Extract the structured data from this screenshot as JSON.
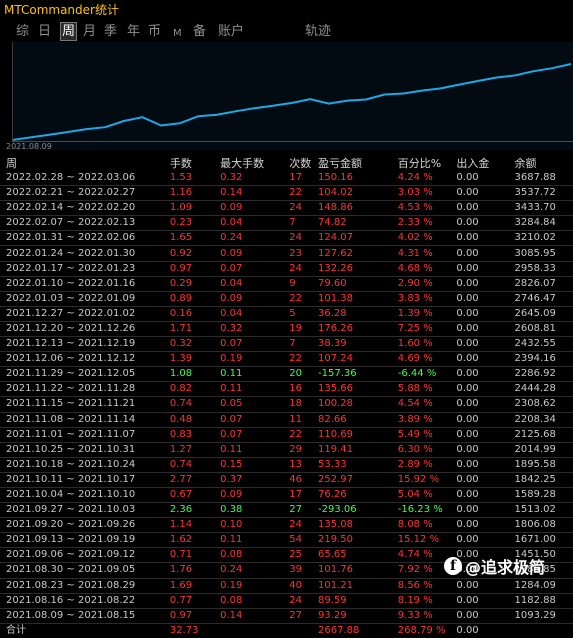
{
  "app": {
    "title": "MTCommander统计"
  },
  "tabs": [
    "综",
    "日",
    "周",
    "月",
    "季",
    "年",
    "币",
    "M",
    "备",
    "账户",
    "轨迹"
  ],
  "active_tab": "周",
  "chart": {
    "start_label": "2021.08.09",
    "line_color": "#1fa8e8"
  },
  "table": {
    "headers": [
      "周",
      "手数",
      "最大手数",
      "次数",
      "盈亏金额",
      "百分比%",
      "出入金",
      "余额"
    ],
    "rows": [
      {
        "week": "2022.02.28 ~ 2022.03.06",
        "lots": "1.53",
        "max_lots": "0.32",
        "count": "17",
        "pnl": "150.16",
        "pct": "4.24 %",
        "io": "0.00",
        "balance": "3687.88",
        "dir": "red"
      },
      {
        "week": "2022.02.21 ~ 2022.02.27",
        "lots": "1.16",
        "max_lots": "0.14",
        "count": "22",
        "pnl": "104.02",
        "pct": "3.03 %",
        "io": "0.00",
        "balance": "3537.72",
        "dir": "red"
      },
      {
        "week": "2022.02.14 ~ 2022.02.20",
        "lots": "1.09",
        "max_lots": "0.09",
        "count": "24",
        "pnl": "148.86",
        "pct": "4.53 %",
        "io": "0.00",
        "balance": "3433.70",
        "dir": "red"
      },
      {
        "week": "2022.02.07 ~ 2022.02.13",
        "lots": "0.23",
        "max_lots": "0.04",
        "count": "7",
        "pnl": "74.82",
        "pct": "2.33 %",
        "io": "0.00",
        "balance": "3284.84",
        "dir": "red"
      },
      {
        "week": "2022.01.31 ~ 2022.02.06",
        "lots": "1.65",
        "max_lots": "0.24",
        "count": "24",
        "pnl": "124.07",
        "pct": "4.02 %",
        "io": "0.00",
        "balance": "3210.02",
        "dir": "red"
      },
      {
        "week": "2022.01.24 ~ 2022.01.30",
        "lots": "0.92",
        "max_lots": "0.09",
        "count": "23",
        "pnl": "127.62",
        "pct": "4.31 %",
        "io": "0.00",
        "balance": "3085.95",
        "dir": "red"
      },
      {
        "week": "2022.01.17 ~ 2022.01.23",
        "lots": "0.97",
        "max_lots": "0.07",
        "count": "24",
        "pnl": "132.26",
        "pct": "4.68 %",
        "io": "0.00",
        "balance": "2958.33",
        "dir": "red"
      },
      {
        "week": "2022.01.10 ~ 2022.01.16",
        "lots": "0.29",
        "max_lots": "0.04",
        "count": "9",
        "pnl": "79.60",
        "pct": "2.90 %",
        "io": "0.00",
        "balance": "2826.07",
        "dir": "red"
      },
      {
        "week": "2022.01.03 ~ 2022.01.09",
        "lots": "0.89",
        "max_lots": "0.09",
        "count": "22",
        "pnl": "101.38",
        "pct": "3.83 %",
        "io": "0.00",
        "balance": "2746.47",
        "dir": "red"
      },
      {
        "week": "2021.12.27 ~ 2022.01.02",
        "lots": "0.16",
        "max_lots": "0.04",
        "count": "5",
        "pnl": "36.28",
        "pct": "1.39 %",
        "io": "0.00",
        "balance": "2645.09",
        "dir": "red"
      },
      {
        "week": "2021.12.20 ~ 2021.12.26",
        "lots": "1.71",
        "max_lots": "0.32",
        "count": "19",
        "pnl": "176.26",
        "pct": "7.25 %",
        "io": "0.00",
        "balance": "2608.81",
        "dir": "red"
      },
      {
        "week": "2021.12.13 ~ 2021.12.19",
        "lots": "0.32",
        "max_lots": "0.07",
        "count": "7",
        "pnl": "38.39",
        "pct": "1.60 %",
        "io": "0.00",
        "balance": "2432.55",
        "dir": "red"
      },
      {
        "week": "2021.12.06 ~ 2021.12.12",
        "lots": "1.39",
        "max_lots": "0.19",
        "count": "22",
        "pnl": "107.24",
        "pct": "4.69 %",
        "io": "0.00",
        "balance": "2394.16",
        "dir": "red"
      },
      {
        "week": "2021.11.29 ~ 2021.12.05",
        "lots": "1.08",
        "max_lots": "0.11",
        "count": "20",
        "pnl": "-157.36",
        "pct": "-6.44 %",
        "io": "0.00",
        "balance": "2286.92",
        "dir": "green"
      },
      {
        "week": "2021.11.22 ~ 2021.11.28",
        "lots": "0.82",
        "max_lots": "0.11",
        "count": "16",
        "pnl": "135.66",
        "pct": "5.88 %",
        "io": "0.00",
        "balance": "2444.28",
        "dir": "red"
      },
      {
        "week": "2021.11.15 ~ 2021.11.21",
        "lots": "0.74",
        "max_lots": "0.05",
        "count": "18",
        "pnl": "100.28",
        "pct": "4.54 %",
        "io": "0.00",
        "balance": "2308.62",
        "dir": "red"
      },
      {
        "week": "2021.11.08 ~ 2021.11.14",
        "lots": "0.48",
        "max_lots": "0.07",
        "count": "11",
        "pnl": "82.66",
        "pct": "3.89 %",
        "io": "0.00",
        "balance": "2208.34",
        "dir": "red"
      },
      {
        "week": "2021.11.01 ~ 2021.11.07",
        "lots": "0.83",
        "max_lots": "0.07",
        "count": "22",
        "pnl": "110.69",
        "pct": "5.49 %",
        "io": "0.00",
        "balance": "2125.68",
        "dir": "red"
      },
      {
        "week": "2021.10.25 ~ 2021.10.31",
        "lots": "1.27",
        "max_lots": "0.11",
        "count": "29",
        "pnl": "119.41",
        "pct": "6.30 %",
        "io": "0.00",
        "balance": "2014.99",
        "dir": "red"
      },
      {
        "week": "2021.10.18 ~ 2021.10.24",
        "lots": "0.74",
        "max_lots": "0.15",
        "count": "13",
        "pnl": "53.33",
        "pct": "2.89 %",
        "io": "0.00",
        "balance": "1895.58",
        "dir": "red"
      },
      {
        "week": "2021.10.11 ~ 2021.10.17",
        "lots": "2.77",
        "max_lots": "0.37",
        "count": "46",
        "pnl": "252.97",
        "pct": "15.92 %",
        "io": "0.00",
        "balance": "1842.25",
        "dir": "red"
      },
      {
        "week": "2021.10.04 ~ 2021.10.10",
        "lots": "0.67",
        "max_lots": "0.09",
        "count": "17",
        "pnl": "76.26",
        "pct": "5.04 %",
        "io": "0.00",
        "balance": "1589.28",
        "dir": "red"
      },
      {
        "week": "2021.09.27 ~ 2021.10.03",
        "lots": "2.36",
        "max_lots": "0.38",
        "count": "27",
        "pnl": "-293.06",
        "pct": "-16.23 %",
        "io": "0.00",
        "balance": "1513.02",
        "dir": "green"
      },
      {
        "week": "2021.09.20 ~ 2021.09.26",
        "lots": "1.14",
        "max_lots": "0.10",
        "count": "24",
        "pnl": "135.08",
        "pct": "8.08 %",
        "io": "0.00",
        "balance": "1806.08",
        "dir": "red"
      },
      {
        "week": "2021.09.13 ~ 2021.09.19",
        "lots": "1.62",
        "max_lots": "0.11",
        "count": "54",
        "pnl": "219.50",
        "pct": "15.12 %",
        "io": "0.00",
        "balance": "1671.00",
        "dir": "red"
      },
      {
        "week": "2021.09.06 ~ 2021.09.12",
        "lots": "0.71",
        "max_lots": "0.08",
        "count": "25",
        "pnl": "65.65",
        "pct": "4.74 %",
        "io": "0.00",
        "balance": "1451.50",
        "dir": "red"
      },
      {
        "week": "2021.08.30 ~ 2021.09.05",
        "lots": "1.76",
        "max_lots": "0.24",
        "count": "39",
        "pnl": "101.76",
        "pct": "7.92 %",
        "io": "0.00",
        "balance": "1385.85",
        "dir": "red"
      },
      {
        "week": "2021.08.23 ~ 2021.08.29",
        "lots": "1.69",
        "max_lots": "0.19",
        "count": "40",
        "pnl": "101.21",
        "pct": "8.56 %",
        "io": "0.00",
        "balance": "1284.09",
        "dir": "red"
      },
      {
        "week": "2021.08.16 ~ 2021.08.22",
        "lots": "0.77",
        "max_lots": "0.08",
        "count": "24",
        "pnl": "89.59",
        "pct": "8.19 %",
        "io": "0.00",
        "balance": "1182.88",
        "dir": "red"
      },
      {
        "week": "2021.08.09 ~ 2021.08.15",
        "lots": "0.97",
        "max_lots": "0.14",
        "count": "27",
        "pnl": "93.29",
        "pct": "9.33 %",
        "io": "0.00",
        "balance": "1093.29",
        "dir": "red"
      }
    ],
    "total": {
      "label": "合计",
      "lots": "32.73",
      "pnl": "2667.88",
      "pct": "268.79 %",
      "io": "0.00"
    }
  },
  "watermark": {
    "text": "@追求极简"
  }
}
